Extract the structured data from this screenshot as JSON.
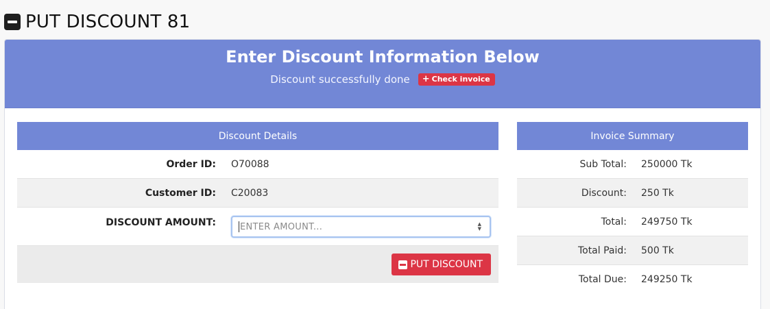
{
  "page": {
    "title": "PUT DISCOUNT 81"
  },
  "card": {
    "heading": "Enter Discount Information Below",
    "status_text": "Discount successfully done",
    "check_invoice_label": "Check invoice"
  },
  "discount_details": {
    "title": "Discount Details",
    "order_id_label": "Order ID:",
    "order_id": "O70088",
    "customer_id_label": "Customer ID:",
    "customer_id": "C20083",
    "amount_label": "DISCOUNT AMOUNT:",
    "amount_value": "",
    "amount_placeholder": "ENTER AMOUNT...",
    "submit_label": "PUT DISCOUNT"
  },
  "invoice_summary": {
    "title": "Invoice Summary",
    "rows": [
      {
        "label": "Sub Total:",
        "value": "250000 Tk"
      },
      {
        "label": "Discount:",
        "value": "250 Tk"
      },
      {
        "label": "Total:",
        "value": "249750 Tk"
      },
      {
        "label": "Total Paid:",
        "value": "500 Tk"
      },
      {
        "label": "Total Due:",
        "value": "249250 Tk"
      }
    ]
  },
  "colors": {
    "header_blue": "#7287d6",
    "danger_red": "#dc3545"
  }
}
